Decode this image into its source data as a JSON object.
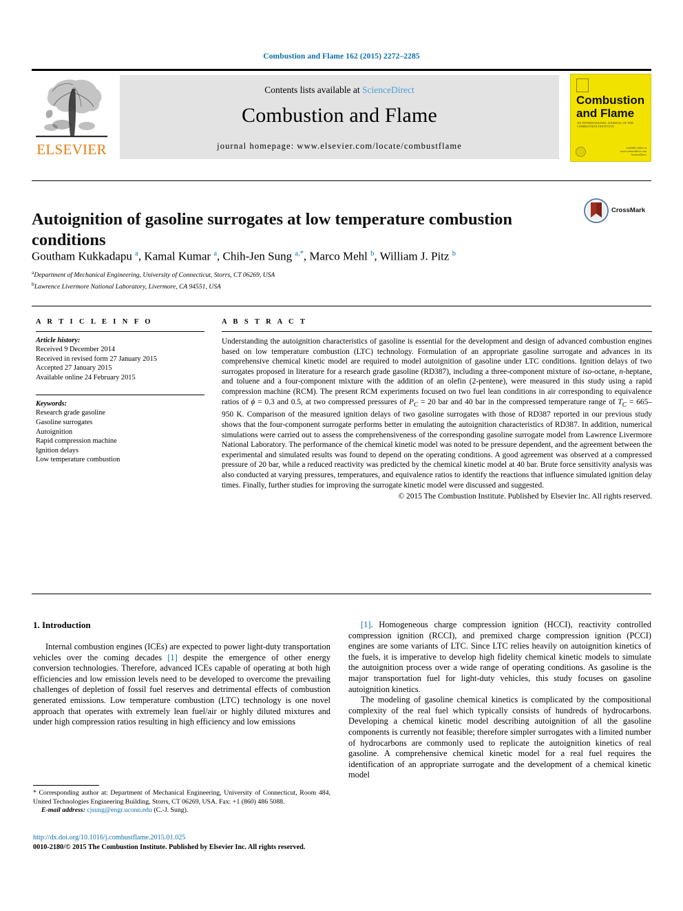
{
  "running_head": "Combustion and Flame 162 (2015) 2272–2285",
  "masthead": {
    "publisher": "ELSEVIER",
    "contents_prefix": "Contents lists available at ",
    "contents_link": "ScienceDirect",
    "journal_title": "Combustion and Flame",
    "homepage": "journal homepage: www.elsevier.com/locate/combustflame",
    "cover": {
      "line1": "Combustion",
      "line2": "and Flame",
      "subtitle": "AN INTERNATIONAL JOURNAL OF THE COMBUSTION INSTITUTE",
      "footer": "available online at www.sciencedirect.com ScienceDirect"
    }
  },
  "article": {
    "title": "Autoignition of gasoline surrogates at low temperature combustion conditions",
    "crossmark_label": "CrossMark",
    "authors_html": "Goutham Kukkadapu <sup>a</sup>, Kamal Kumar <sup>a</sup>, Chih-Jen Sung <sup>a,*</sup>, Marco Mehl <sup>b</sup>, William J. Pitz <sup>b</sup>",
    "affiliations": [
      "Department of Mechanical Engineering, University of Connecticut, Storrs, CT 06269, USA",
      "Lawrence Livermore National Laboratory, Livermore, CA 94551, USA"
    ]
  },
  "article_info": {
    "heading": "A R T I C L E   I N F O",
    "history_label": "Article history:",
    "history": [
      "Received 9 December 2014",
      "Received in revised form 27 January 2015",
      "Accepted 27 January 2015",
      "Available online 24 February 2015"
    ],
    "keywords_label": "Keywords:",
    "keywords": [
      "Research grade gasoline",
      "Gasoline surrogates",
      "Autoignition",
      "Rapid compression machine",
      "Ignition delays",
      "Low temperature combustion"
    ]
  },
  "abstract": {
    "heading": "A B S T R A C T",
    "body_html": "Understanding the autoignition characteristics of gasoline is essential for the development and design of advanced combustion engines based on low temperature combustion (LTC) technology. Formulation of an appropriate gasoline surrogate and advances in its comprehensive chemical kinetic model are required to model autoignition of gasoline under LTC conditions. Ignition delays of two surrogates proposed in literature for a research grade gasoline (RD387), including a three-component mixture of <i>iso</i>-octane, <i>n</i>-heptane, and toluene and a four-component mixture with the addition of an olefin (2-pentene), were measured in this study using a rapid compression machine (RCM). The present RCM experiments focused on two fuel lean conditions in air corresponding to equivalence ratios of <i>&#981;</i>&#160;=&#160;0.3 and 0.5, at two compressed pressures of <i>P<sub>C</sub></i>&#160;=&#160;20&#160;bar and 40&#160;bar in the compressed temperature range of <i>T<sub>C</sub></i>&#160;=&#160;665&#8211;950&#160;K. Comparison of the measured ignition delays of two gasoline surrogates with those of RD387 reported in our previous study shows that the four-component surrogate performs better in emulating the autoignition characteristics of RD387. In addition, numerical simulations were carried out to assess the comprehensiveness of the corresponding gasoline surrogate model from Lawrence Livermore National Laboratory. The performance of the chemical kinetic model was noted to be pressure dependent, and the agreement between the experimental and simulated results was found to depend on the operating conditions. A good agreement was observed at a compressed pressure of 20&#160;bar, while a reduced reactivity was predicted by the chemical kinetic model at 40&#160;bar. Brute force sensitivity analysis was also conducted at varying pressures, temperatures, and equivalence ratios to identify the reactions that influence simulated ignition delay times. Finally, further studies for improving the surrogate kinetic model were discussed and suggested.",
    "copyright": "© 2015 The Combustion Institute. Published by Elsevier Inc. All rights reserved."
  },
  "body": {
    "section_heading": "1. Introduction",
    "left_paragraphs_html": [
      "Internal combustion engines (ICEs) are expected to power light-duty transportation vehicles over the coming decades <span class=\"ref\">[1]</span> despite the emergence of other energy conversion technologies. Therefore, advanced ICEs capable of operating at both high efficiencies and low emission levels need to be developed to overcome the prevailing challenges of depletion of fossil fuel reserves and detrimental effects of combustion generated emissions. Low temperature combustion (LTC) technology is one novel approach that operates with extremely lean fuel/air or highly diluted mixtures and under high compression ratios resulting in high efficiency and low emissions"
    ],
    "right_paragraphs_html": [
      "<span class=\"ref\">[1]</span>. Homogeneous charge compression ignition (HCCI), reactivity controlled compression ignition (RCCI), and premixed charge compression ignition (PCCI) engines are some variants of LTC. Since LTC relies heavily on autoignition kinetics of the fuels, it is imperative to develop high fidelity chemical kinetic models to simulate the autoignition process over a wide range of operating conditions. As gasoline is the major transportation fuel for light-duty vehicles, this study focuses on gasoline autoignition kinetics.",
      "The modeling of gasoline chemical kinetics is complicated by the compositional complexity of the real fuel which typically consists of hundreds of hydrocarbons. Developing a chemical kinetic model describing autoignition of all the gasoline components is currently not feasible; therefore simpler surrogates with a limited number of hydrocarbons are commonly used to replicate the autoignition kinetics of real gasoline. A comprehensive chemical kinetic model for a real fuel requires the identification of an appropriate surrogate and the development of a chemical kinetic model"
    ]
  },
  "footnote": {
    "corresponding_html": "* Corresponding author at: Department of Mechanical Engineering, University of Connecticut, Room 484, United Technologies Engineering Building, Storrs, CT 06269, USA. Fax: +1 (860) 486 5088.",
    "email_label": "E-mail address:",
    "email": "cjsung@engr.uconn.edu",
    "email_owner": "(C.-J. Sung)."
  },
  "doi_block": {
    "doi": "http://dx.doi.org/10.1016/j.combustflame.2015.01.025",
    "issn": "0010-2180/© 2015 The Combustion Institute. Published by Elsevier Inc. All rights reserved."
  }
}
